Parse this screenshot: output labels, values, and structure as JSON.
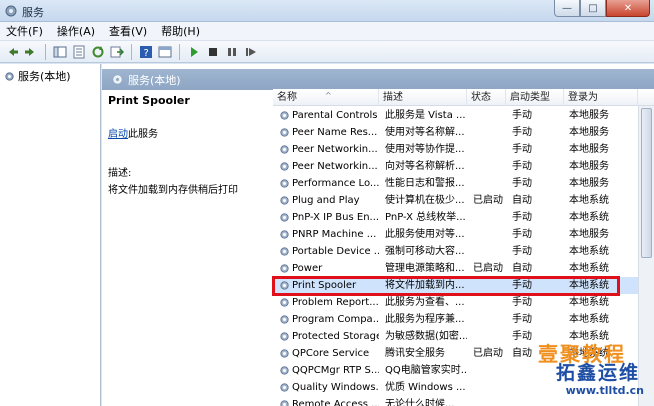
{
  "window": {
    "title": "服务",
    "minimize": "—",
    "maximize": "□",
    "close": "✕"
  },
  "menu": {
    "file": "文件(F)",
    "action": "操作(A)",
    "view": "查看(V)",
    "help": "帮助(H)"
  },
  "toolbar_icons": [
    "back-icon",
    "forward-icon",
    "show-hide-tree-icon",
    "properties-icon",
    "refresh-icon",
    "export-icon",
    "help-icon",
    "console-icon",
    "play-icon",
    "stop-icon",
    "pause-icon",
    "restart-icon"
  ],
  "left_tree": {
    "label": "服务(本地)"
  },
  "pane_header": {
    "label": "服务(本地)"
  },
  "detail": {
    "service_name": "Print Spooler",
    "start_link": "启动",
    "start_suffix": "此服务",
    "desc_label": "描述:",
    "desc_text": "将文件加载到内存供稍后打印"
  },
  "table": {
    "headers": {
      "name": "名称",
      "desc": "描述",
      "status": "状态",
      "startup": "启动类型",
      "logon": "登录为"
    },
    "rows": [
      {
        "name": "Parental Controls",
        "desc": "此服务是 Vista ...",
        "status": "",
        "startup": "手动",
        "logon": "本地服务"
      },
      {
        "name": "Peer Name Res...",
        "desc": "使用对等名称解...",
        "status": "",
        "startup": "手动",
        "logon": "本地服务"
      },
      {
        "name": "Peer Networkin...",
        "desc": "使用对等协作提...",
        "status": "",
        "startup": "手动",
        "logon": "本地服务"
      },
      {
        "name": "Peer Networkin...",
        "desc": "向对等名称解析...",
        "status": "",
        "startup": "手动",
        "logon": "本地服务"
      },
      {
        "name": "Performance Lo...",
        "desc": "性能日志和警报...",
        "status": "",
        "startup": "手动",
        "logon": "本地服务"
      },
      {
        "name": "Plug and Play",
        "desc": "使计算机在极少...",
        "status": "已启动",
        "startup": "自动",
        "logon": "本地系统"
      },
      {
        "name": "PnP-X IP Bus En...",
        "desc": "PnP-X 总线枚举...",
        "status": "",
        "startup": "手动",
        "logon": "本地系统"
      },
      {
        "name": "PNRP Machine ...",
        "desc": "此服务使用对等...",
        "status": "",
        "startup": "手动",
        "logon": "本地服务"
      },
      {
        "name": "Portable Device ...",
        "desc": "强制可移动大容...",
        "status": "",
        "startup": "手动",
        "logon": "本地系统"
      },
      {
        "name": "Power",
        "desc": "管理电源策略和...",
        "status": "已启动",
        "startup": "自动",
        "logon": "本地系统"
      },
      {
        "name": "Print Spooler",
        "desc": "将文件加载到内...",
        "status": "",
        "startup": "手动",
        "logon": "本地系统"
      },
      {
        "name": "Problem Report...",
        "desc": "此服务为查看、...",
        "status": "",
        "startup": "手动",
        "logon": "本地系统"
      },
      {
        "name": "Program Compa...",
        "desc": "此服务为程序兼...",
        "status": "",
        "startup": "手动",
        "logon": "本地系统"
      },
      {
        "name": "Protected Storage",
        "desc": "为敏感数据(如密...",
        "status": "",
        "startup": "手动",
        "logon": "本地系统"
      },
      {
        "name": "QPCore Service",
        "desc": "腾讯安全服务",
        "status": "已启动",
        "startup": "自动",
        "logon": "本地系统"
      },
      {
        "name": "QQPCMgr RTP S...",
        "desc": "QQ电脑管家实时...",
        "status": "",
        "startup": "",
        "logon": ""
      },
      {
        "name": "Quality Windows...",
        "desc": "优质 Windows ...",
        "status": "",
        "startup": "",
        "logon": ""
      },
      {
        "name": "Remote Access ...",
        "desc": "无论什么时候...",
        "status": "",
        "startup": "",
        "logon": ""
      }
    ]
  },
  "watermark": {
    "line1": "壹聚教程",
    "line2": "拓鑫运维",
    "line3": "www.tlltd.cn"
  }
}
